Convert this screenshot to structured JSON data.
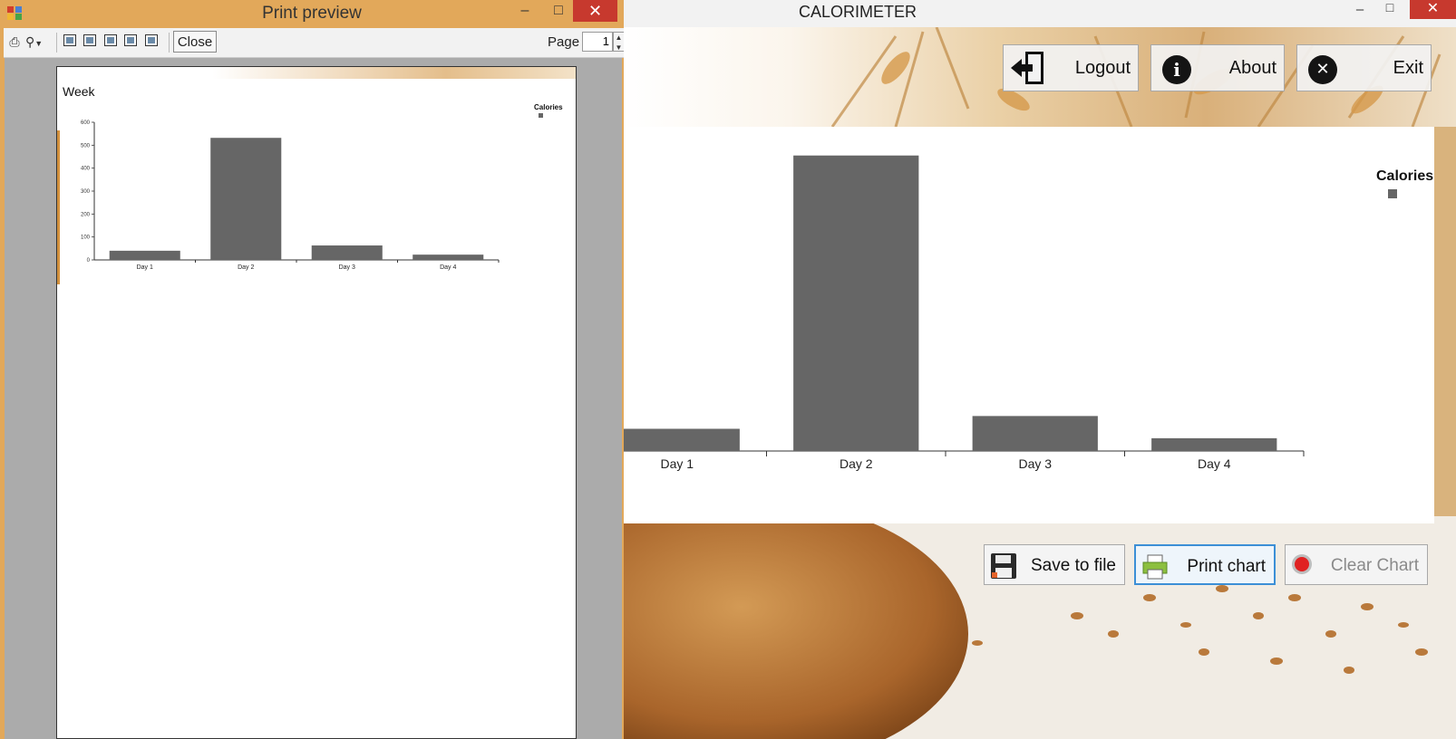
{
  "print_preview": {
    "title": "Print preview",
    "toolbar": {
      "close_label": "Close",
      "page_label": "Page",
      "page_value": "1"
    },
    "page": {
      "heading": "Week"
    }
  },
  "calorimeter": {
    "title": "CALORIMETER",
    "header_buttons": {
      "logout": "Logout",
      "about": "About",
      "exit": "Exit"
    },
    "bottom_buttons": {
      "save": "Save to file",
      "print": "Print chart",
      "clear": "Clear Chart"
    }
  },
  "chart_data": [
    {
      "type": "bar",
      "categories": [
        "Day 1",
        "Day 2",
        "Day 3",
        "Day 4"
      ],
      "series": [
        {
          "name": "Calories",
          "values": [
            40,
            532,
            63,
            23
          ]
        }
      ],
      "ylim": [
        0,
        600
      ],
      "yticks": [
        0,
        100,
        200,
        300,
        400,
        500,
        600
      ],
      "title": "Week",
      "legend": "top-right",
      "grid": false,
      "bar_color": "#666666"
    },
    {
      "type": "bar",
      "categories": [
        "Day 1",
        "Day 2",
        "Day 3",
        "Day 4"
      ],
      "series": [
        {
          "name": "Calories",
          "values": [
            40,
            532,
            63,
            23
          ]
        }
      ],
      "legend": "top-right",
      "grid": false,
      "bar_color": "#666666"
    }
  ],
  "colors": {
    "window_border": "#D59D4A",
    "close_red": "#C7392E",
    "bar": "#666666",
    "focus_blue": "#3C8FD6"
  }
}
